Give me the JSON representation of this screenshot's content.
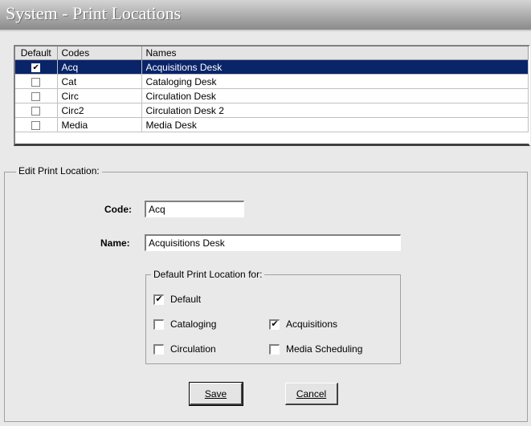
{
  "window": {
    "title": "System - Print Locations"
  },
  "grid": {
    "columns": [
      "Default",
      "Codes",
      "Names"
    ],
    "rows": [
      {
        "default": true,
        "code": "Acq",
        "name": "Acquisitions Desk",
        "selected": true
      },
      {
        "default": false,
        "code": "Cat",
        "name": "Cataloging Desk",
        "selected": false
      },
      {
        "default": false,
        "code": "Circ",
        "name": "Circulation Desk",
        "selected": false
      },
      {
        "default": false,
        "code": "Circ2",
        "name": "Circulation Desk 2",
        "selected": false
      },
      {
        "default": false,
        "code": "Media",
        "name": "Media Desk",
        "selected": false
      }
    ]
  },
  "edit": {
    "group_label": "Edit  Print Location:",
    "code_label": "Code:",
    "code_value": "Acq",
    "name_label": "Name:",
    "name_value": "Acquisitions Desk",
    "defaults_label": "Default Print Location for:",
    "checkboxes": {
      "default": {
        "label": "Default",
        "checked": true
      },
      "cataloging": {
        "label": "Cataloging",
        "checked": false
      },
      "acquisitions": {
        "label": "Acquisitions",
        "checked": true
      },
      "circulation": {
        "label": "Circulation",
        "checked": false
      },
      "media": {
        "label": "Media Scheduling",
        "checked": false
      }
    },
    "save_label": "Save",
    "cancel_label": "Cancel"
  },
  "colors": {
    "selection": "#0a246a",
    "window_bg": "#e9e9e9"
  }
}
